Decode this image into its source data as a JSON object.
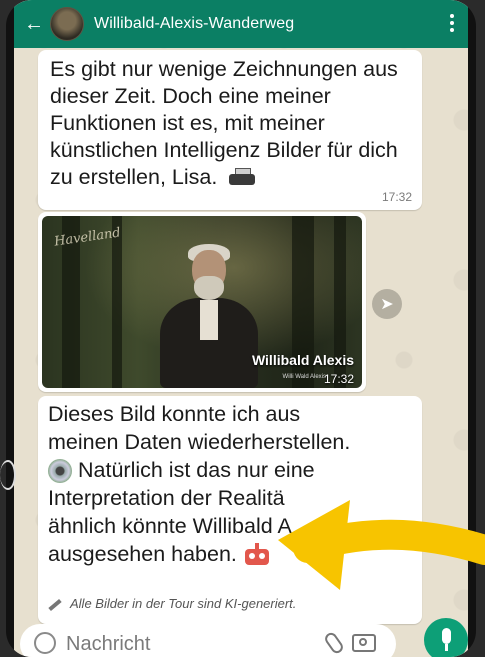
{
  "header": {
    "title": "Willibald-Alexis-Wanderweg"
  },
  "messages": [
    {
      "text": "Es gibt nur wenige Zeichnungen aus dieser Zeit. Doch eine meiner Funktionen ist es, mit meiner künstlichen Intelligenz Bilder für dich zu erstellen, Lisa.",
      "time": "17:32",
      "emoji": "printer-icon"
    },
    {
      "type": "image",
      "signature": "Havelland",
      "caption": "Willibald Alexis",
      "subcaption": "Willi Wald Alexis",
      "time": "17:32"
    },
    {
      "line1": "Dieses Bild konnte ich aus",
      "line2": "meinen Daten wiederherstellen.",
      "line3": "Natürlich ist das nur eine",
      "line4": "Interpretation der Realitä",
      "line5": "ähnlich könnte Willibald A",
      "line6": "ausgesehen haben.",
      "footnote": "Alle Bilder in der Tour sind KI-generiert."
    }
  ],
  "input": {
    "placeholder": "Nachricht"
  },
  "colors": {
    "header": "#0b7f64",
    "mic": "#0d9f77",
    "arrow": "#f7c400",
    "wallpaper": "#e7e0cf"
  }
}
